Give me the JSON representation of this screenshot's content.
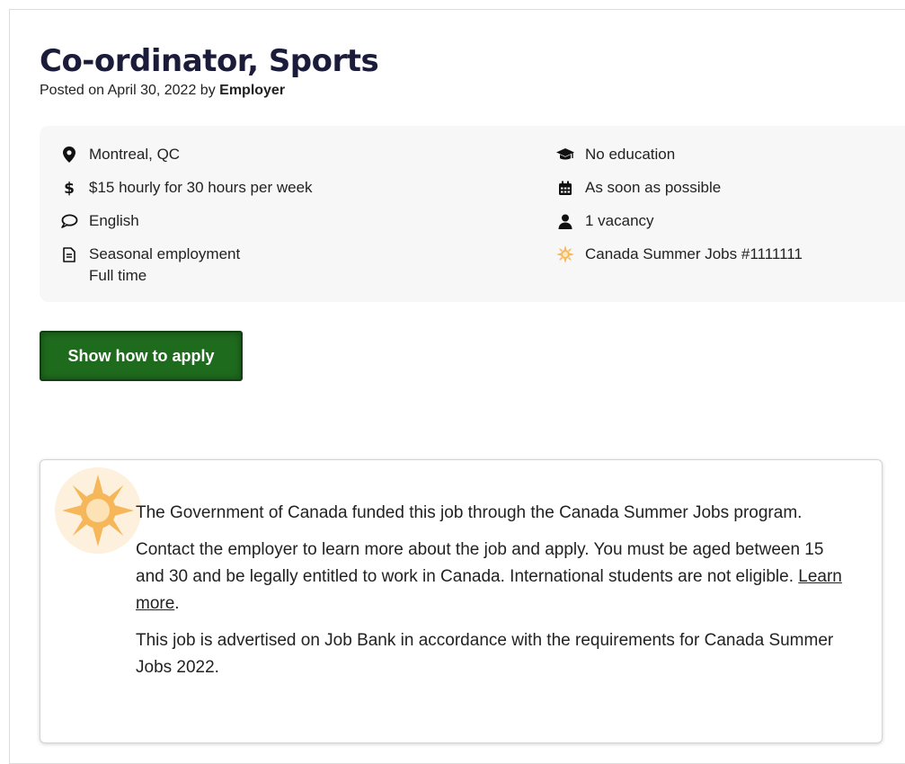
{
  "job": {
    "title": "Co-ordinator, Sports",
    "posted_prefix": "Posted on April 30, 2022 by ",
    "posted_by": "Employer"
  },
  "details": {
    "location": "Montreal, QC",
    "salary": "$15 hourly for 30 hours per week",
    "language": "English",
    "employment_type": "Seasonal employment",
    "schedule": "Full time",
    "education": "No education",
    "start": "As soon as possible",
    "vacancy": "1 vacancy",
    "program": "Canada Summer Jobs #1111111"
  },
  "apply": {
    "label": "Show how to apply"
  },
  "csj": {
    "para1": "The Government of Canada funded this job through the Canada Summer Jobs program.",
    "para2_prefix": "Contact the employer to learn more about the job and apply. You must be aged between 15 and 30 and be legally entitled to work in Canada. International students are not eligible. ",
    "learn_more": "Learn more",
    "para2_suffix": ".",
    "para3": "This job is advertised on Job Bank in accordance with the requirements for Canada Summer Jobs 2022."
  },
  "colors": {
    "title": "#1b1b3a",
    "button_bg": "#1f6b1e",
    "panel_bg": "#f7f7f7",
    "sun": "#f5b75a"
  },
  "icons": [
    "location-pin-icon",
    "dollar-icon",
    "speech-bubble-icon",
    "document-icon",
    "graduation-cap-icon",
    "calendar-icon",
    "person-icon",
    "sun-icon"
  ]
}
